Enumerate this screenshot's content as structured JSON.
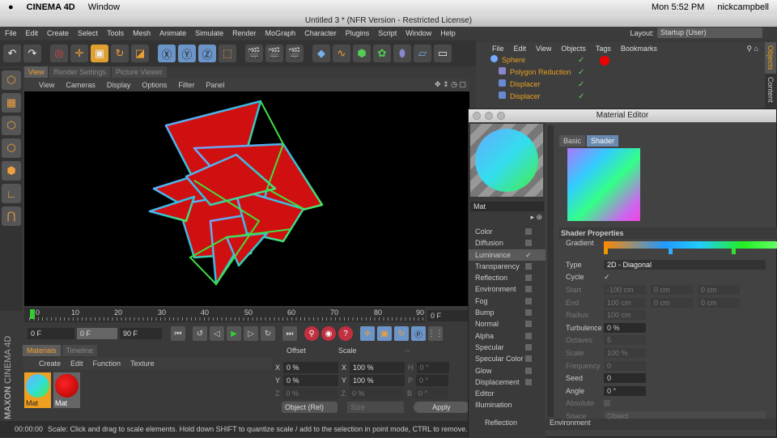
{
  "mac_menubar": {
    "app": "CINEMA 4D",
    "menu": "Window",
    "clock": "Mon 5:52 PM",
    "user": "nickcampbell"
  },
  "window_title": "Untitled 3 * (NFR Version - Restricted License)",
  "app_menu": [
    "File",
    "Edit",
    "Create",
    "Select",
    "Tools",
    "Mesh",
    "Animate",
    "Simulate",
    "Render",
    "MoGraph",
    "Character",
    "Plugins",
    "Script",
    "Window",
    "Help"
  ],
  "layout": {
    "label": "Layout:",
    "value": "Startup (User)"
  },
  "viewport": {
    "tabs": [
      "View",
      "Render Settings",
      "Picture Viewer"
    ],
    "menu": [
      "View",
      "Cameras",
      "Display",
      "Options",
      "Filter",
      "Panel"
    ]
  },
  "timeline": {
    "ticks": [
      "0",
      "10",
      "20",
      "30",
      "40",
      "50",
      "60",
      "70",
      "80",
      "90"
    ],
    "current": "0 F",
    "start": "0 F",
    "preview": "0 F",
    "end": "90 F",
    "progress": 0
  },
  "materials": {
    "tabs": [
      "Materials",
      "Timeline"
    ],
    "menu": [
      "Create",
      "Edit",
      "Function",
      "Texture"
    ],
    "items": [
      {
        "name": "Mat",
        "color": "gradient"
      },
      {
        "name": "Mat",
        "color": "#d00000"
      }
    ]
  },
  "attributes": {
    "headers": [
      "Offset",
      "Scale",
      "--"
    ],
    "rows": [
      [
        "X",
        "0 %",
        "X",
        "100 %",
        "H",
        "0 °"
      ],
      [
        "Y",
        "0 %",
        "Y",
        "100 %",
        "P",
        "0 °"
      ],
      [
        "Z",
        "0 %",
        "Z",
        "0 %",
        "B",
        "0 °"
      ]
    ],
    "mode": "Object (Rel)",
    "size": "Size",
    "apply": "Apply"
  },
  "status": {
    "time": "00:00:00",
    "message": "Scale: Click and drag to scale elements. Hold down SHIFT to quantize scale / add to the selection in point mode, CTRL to remove."
  },
  "brand": {
    "maxon": "MAXON",
    "product": "CINEMA 4D"
  },
  "object_manager": {
    "menu": [
      "File",
      "Edit",
      "View",
      "Objects",
      "Tags",
      "Bookmarks"
    ],
    "objects": [
      "Sphere",
      "Polygon Reduction",
      "Displacer",
      "Displacer"
    ],
    "side_tabs": [
      "Objects",
      "Content"
    ]
  },
  "material_editor": {
    "title": "Material Editor",
    "name": "Mat",
    "tabs": [
      "Basic",
      "Shader"
    ],
    "channels": [
      {
        "l": "Color",
        "c": false
      },
      {
        "l": "Diffusion",
        "c": false
      },
      {
        "l": "Luminance",
        "c": true
      },
      {
        "l": "Transparency",
        "c": false
      },
      {
        "l": "Reflection",
        "c": false
      },
      {
        "l": "Environment",
        "c": false
      },
      {
        "l": "Fog",
        "c": false
      },
      {
        "l": "Bump",
        "c": false
      },
      {
        "l": "Normal",
        "c": false
      },
      {
        "l": "Alpha",
        "c": false
      },
      {
        "l": "Specular",
        "c": false
      },
      {
        "l": "Specular Color",
        "c": false
      },
      {
        "l": "Glow",
        "c": false
      },
      {
        "l": "Displacement",
        "c": false
      },
      {
        "l": "Editor",
        "c": false
      },
      {
        "l": "Illumination",
        "c": false
      }
    ],
    "bottom_channels": [
      "Reflection",
      "Environment"
    ],
    "shader_title": "Shader Properties",
    "props": {
      "gradient": "Gradient",
      "type_l": "Type",
      "type": "2D - Diagonal",
      "cycle": "Cycle",
      "start": "Start",
      "start_v": [
        "-100 cm",
        "0 cm",
        "0 cm"
      ],
      "end": "End",
      "end_v": [
        "100 cm",
        "0 cm",
        "0 cm"
      ],
      "radius": "Radius",
      "radius_v": "100 cm",
      "turbulence": "Turbulence",
      "turbulence_v": "0 %",
      "octaves": "Octaves",
      "octaves_v": "5",
      "scale": "Scale",
      "scale_v": "100 %",
      "frequency": "Frequency",
      "frequency_v": "0",
      "seed": "Seed",
      "seed_v": "0",
      "angle": "Angle",
      "angle_v": "0 °",
      "absolute": "Absolute",
      "space": "Space",
      "space_v": "Object"
    },
    "checkmark": "✓"
  }
}
